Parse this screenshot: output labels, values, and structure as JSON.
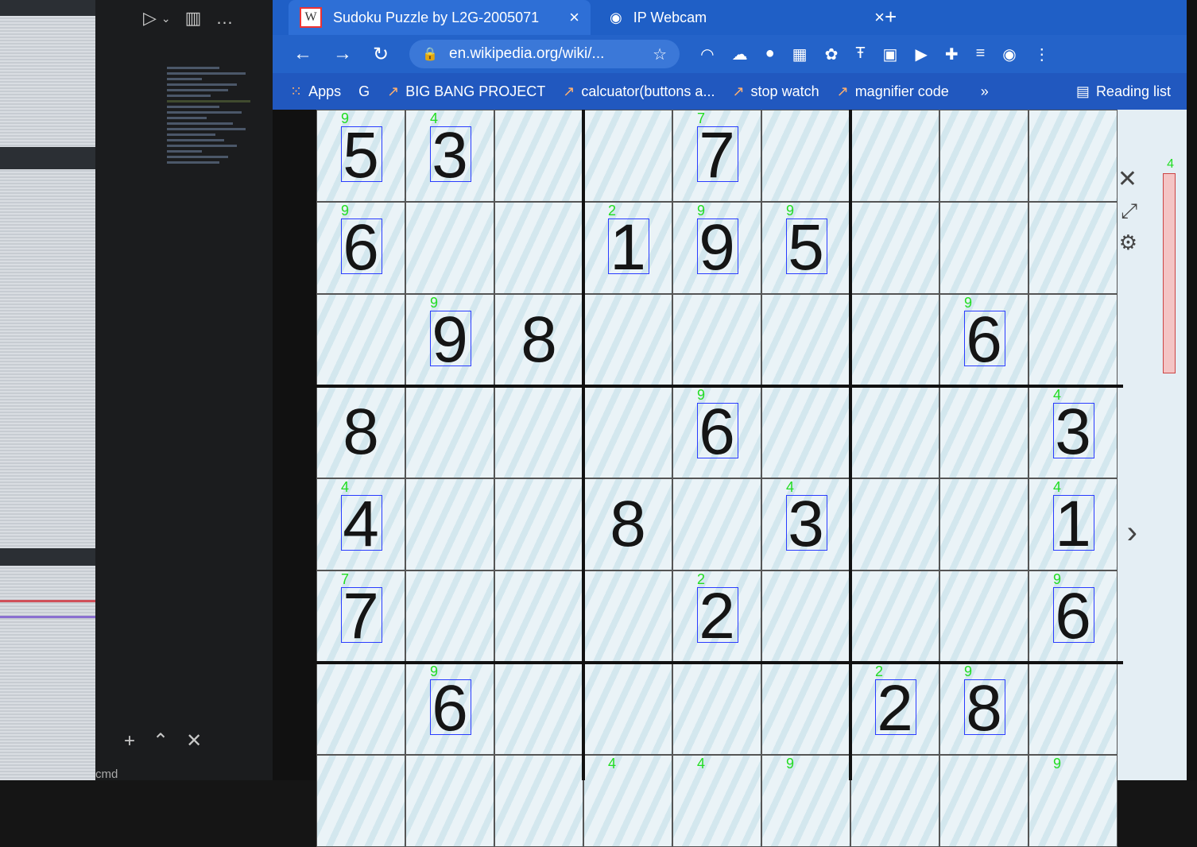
{
  "browser": {
    "tabs": [
      {
        "label": "Sudoku Puzzle by L2G-2005071",
        "close": "×"
      },
      {
        "label": "IP Webcam",
        "close": "×"
      }
    ],
    "new_tab": "+",
    "url": "en.wikipedia.org/wiki/...",
    "bookmarks": [
      {
        "label": "Apps"
      },
      {
        "label": "BIG BANG PROJECT"
      },
      {
        "label": "calcuator(buttons a..."
      },
      {
        "label": "stop watch"
      },
      {
        "label": "magnifier code"
      }
    ],
    "more_bookmarks": "»",
    "reading_list": "Reading list"
  },
  "editor": {
    "bottom_plus": "+",
    "cmd_label": "cmd"
  },
  "sudoku": {
    "cells": [
      {
        "row": 0,
        "col": 0,
        "value": "5",
        "tag": "9"
      },
      {
        "row": 0,
        "col": 1,
        "value": "3",
        "tag": "4"
      },
      {
        "row": 0,
        "col": 4,
        "value": "7",
        "tag": "7"
      },
      {
        "row": 1,
        "col": 0,
        "value": "6",
        "tag": "9"
      },
      {
        "row": 1,
        "col": 3,
        "value": "1",
        "tag": "2"
      },
      {
        "row": 1,
        "col": 4,
        "value": "9",
        "tag": "9"
      },
      {
        "row": 1,
        "col": 5,
        "value": "5",
        "tag": "9"
      },
      {
        "row": 2,
        "col": 1,
        "value": "9",
        "tag": "9"
      },
      {
        "row": 2,
        "col": 2,
        "value": "8",
        "tag": ""
      },
      {
        "row": 2,
        "col": 7,
        "value": "6",
        "tag": "9"
      },
      {
        "row": 3,
        "col": 0,
        "value": "8",
        "tag": ""
      },
      {
        "row": 3,
        "col": 4,
        "value": "6",
        "tag": "9"
      },
      {
        "row": 3,
        "col": 8,
        "value": "3",
        "tag": "4"
      },
      {
        "row": 4,
        "col": 0,
        "value": "4",
        "tag": "4"
      },
      {
        "row": 4,
        "col": 3,
        "value": "8",
        "tag": ""
      },
      {
        "row": 4,
        "col": 5,
        "value": "3",
        "tag": "4"
      },
      {
        "row": 4,
        "col": 8,
        "value": "1",
        "tag": "4"
      },
      {
        "row": 5,
        "col": 0,
        "value": "7",
        "tag": "7"
      },
      {
        "row": 5,
        "col": 4,
        "value": "2",
        "tag": "2"
      },
      {
        "row": 5,
        "col": 8,
        "value": "6",
        "tag": "9"
      },
      {
        "row": 6,
        "col": 1,
        "value": "6",
        "tag": "9"
      },
      {
        "row": 6,
        "col": 6,
        "value": "2",
        "tag": "2"
      },
      {
        "row": 6,
        "col": 7,
        "value": "8",
        "tag": "9"
      },
      {
        "row": 7,
        "col": 3,
        "value": "",
        "tag": "4"
      },
      {
        "row": 7,
        "col": 4,
        "value": "",
        "tag": "4"
      },
      {
        "row": 7,
        "col": 5,
        "value": "",
        "tag": "9"
      },
      {
        "row": 7,
        "col": 8,
        "value": "",
        "tag": "9"
      }
    ],
    "scroll_tag": "4"
  },
  "icons": {
    "back": "arrow-left-icon",
    "forward": "arrow-right-icon",
    "reload": "reload-icon",
    "lock": "lock-icon",
    "star": "star-icon",
    "close_overlay": "close-icon",
    "expand": "expand-icon",
    "settings": "gear-icon",
    "next": "chevron-right-icon"
  }
}
